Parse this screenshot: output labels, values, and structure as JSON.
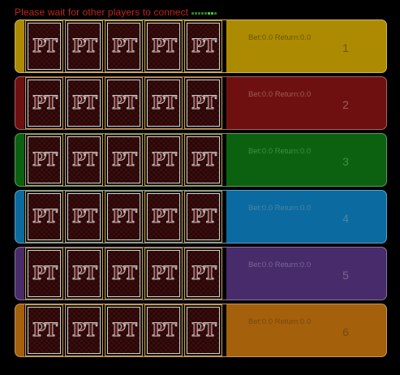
{
  "status": {
    "message": "Please wait for other players to connect",
    "loader_dots": 8,
    "loader_active": [
      5,
      6
    ]
  },
  "card_back_logo": "PT",
  "rows": [
    {
      "color": "#ac8b03",
      "text_color": "#6b5500",
      "bet_label": "Bet:0.0 Return:0.0",
      "number": "1"
    },
    {
      "color": "#6f1010",
      "text_color": "#9e5b5b",
      "bet_label": "Bet:0.0 Return:0.0",
      "number": "2"
    },
    {
      "color": "#0b6110",
      "text_color": "#3f903f",
      "bet_label": "Bet:0.0 Return:0.0",
      "number": "3"
    },
    {
      "color": "#0b6aa0",
      "text_color": "#4a86a5",
      "bet_label": "Bet:0.0 Return:0.0",
      "number": "4"
    },
    {
      "color": "#472b6a",
      "text_color": "#7a6796",
      "bet_label": "Bet:0.0 Return:0.0",
      "number": "5"
    },
    {
      "color": "#a5600c",
      "text_color": "#754a14",
      "bet_label": "Bet:0.0 Return:0.0",
      "number": "6"
    }
  ]
}
